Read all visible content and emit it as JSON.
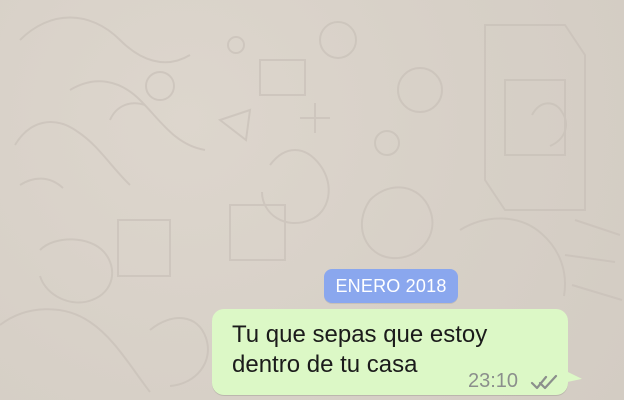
{
  "chat": {
    "date_separator": "ENERO 2018",
    "message": {
      "text_line_1": "Tu que sepas que estoy",
      "text_line_2": "dentro de tu casa",
      "time": "23:10",
      "status_icon": "double-check-icon"
    }
  },
  "colors": {
    "wallpaper": "#d8d1c8",
    "date_chip": "#8aa7ee",
    "bubble": "#dcf8c6",
    "meta_text": "#8b8f8c"
  }
}
